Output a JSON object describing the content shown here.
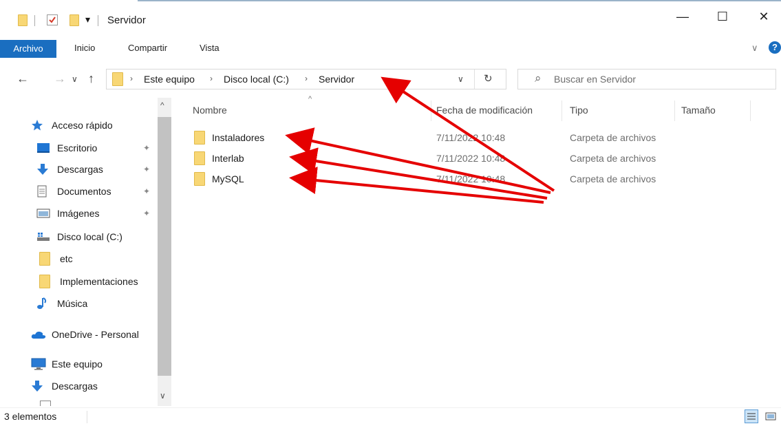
{
  "window": {
    "title": "Servidor",
    "qa_dropdown": "▾"
  },
  "controls": {
    "minimize": "—",
    "maximize": "☐",
    "close": "✕"
  },
  "ribbon": {
    "tabs": [
      "Archivo",
      "Inicio",
      "Compartir",
      "Vista"
    ],
    "expand": "∨",
    "help": "?"
  },
  "nav": {
    "back": "←",
    "forward": "→",
    "recent": "∨",
    "up": "↑"
  },
  "address": {
    "crumbs": [
      "Este equipo",
      "Disco local (C:)",
      "Servidor"
    ],
    "sep": "›",
    "dropdown": "∨",
    "refresh": "↻"
  },
  "search": {
    "placeholder": "Buscar en Servidor",
    "icon": "⌕"
  },
  "sidebar": {
    "items": [
      {
        "label": "Acceso rápido",
        "icon": "star-icon",
        "pinned": false
      },
      {
        "label": "Escritorio",
        "icon": "desktop-icon",
        "pinned": true
      },
      {
        "label": "Descargas",
        "icon": "download-icon",
        "pinned": true
      },
      {
        "label": "Documentos",
        "icon": "document-icon",
        "pinned": true
      },
      {
        "label": "Imágenes",
        "icon": "image-icon",
        "pinned": true
      },
      {
        "label": "Disco local (C:)",
        "icon": "drive-icon",
        "pinned": false
      },
      {
        "label": "etc",
        "icon": "folder-icon",
        "pinned": false
      },
      {
        "label": "Implementaciones",
        "icon": "folder-icon",
        "pinned": false
      },
      {
        "label": "Música",
        "icon": "music-icon",
        "pinned": false
      },
      {
        "label": "OneDrive - Personal",
        "icon": "cloud-icon",
        "pinned": false
      },
      {
        "label": "Este equipo",
        "icon": "computer-icon",
        "pinned": false
      },
      {
        "label": "Descargas",
        "icon": "download-icon",
        "pinned": false
      }
    ],
    "pin_glyph": "✦",
    "scroll_up": "^",
    "scroll_down": "∨"
  },
  "columns": {
    "name": "Nombre",
    "modified": "Fecha de modificación",
    "type": "Tipo",
    "size": "Tamaño",
    "sort": "^"
  },
  "files": [
    {
      "name": "Instaladores",
      "modified": "7/11/2022 10:48",
      "type": "Carpeta de archivos"
    },
    {
      "name": "Interlab",
      "modified": "7/11/2022 10:48",
      "type": "Carpeta de archivos"
    },
    {
      "name": "MySQL",
      "modified": "7/11/2022 10:48",
      "type": "Carpeta de archivos"
    }
  ],
  "status": {
    "count": "3 elementos"
  },
  "colors": {
    "accent": "#1a6ec0",
    "folder": "#f8d775",
    "annotation_arrow": "#e50000"
  }
}
